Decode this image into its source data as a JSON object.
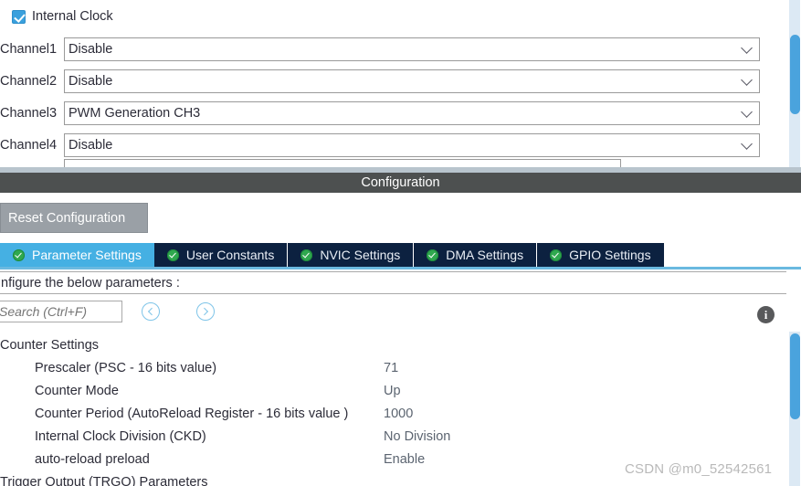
{
  "mode_panel": {
    "internal_clock": {
      "label": "Internal Clock",
      "checked": true
    },
    "channels": [
      {
        "label": "Channel1",
        "value": "Disable"
      },
      {
        "label": "Channel2",
        "value": "Disable"
      },
      {
        "label": "Channel3",
        "value": "PWM Generation CH3"
      },
      {
        "label": "Channel4",
        "value": "Disable"
      }
    ]
  },
  "configuration": {
    "title": "Configuration",
    "reset_button": "Reset Configuration"
  },
  "tabs": [
    {
      "label": "Parameter Settings",
      "active": true,
      "has_check": true
    },
    {
      "label": "User Constants",
      "active": false,
      "has_check": true
    },
    {
      "label": "NVIC Settings",
      "active": false,
      "has_check": true
    },
    {
      "label": "DMA Settings",
      "active": false,
      "has_check": true
    },
    {
      "label": "GPIO Settings",
      "active": false,
      "has_check": true
    }
  ],
  "parameter_panel": {
    "configure_label": "nfigure the below parameters :",
    "search_placeholder": "Search (Ctrl+F)",
    "search_value": "",
    "prev_icon": "chevron-left-circle-icon",
    "next_icon": "chevron-right-circle-icon",
    "info_icon": "info-icon",
    "info_glyph": "i",
    "groups": [
      {
        "name": "Counter Settings",
        "params": [
          {
            "name": "Prescaler (PSC - 16 bits value)",
            "value": "71"
          },
          {
            "name": "Counter Mode",
            "value": "Up"
          },
          {
            "name": "Counter Period (AutoReload Register - 16 bits value )",
            "value": "1000"
          },
          {
            "name": "Internal Clock Division (CKD)",
            "value": "No Division"
          },
          {
            "name": "auto-reload preload",
            "value": "Enable"
          }
        ]
      },
      {
        "name": "Trigger Output (TRGO) Parameters",
        "params": []
      }
    ]
  },
  "watermark": "CSDN @m0_52542561",
  "colors": {
    "accent_blue": "#45b0e3",
    "tab_navy": "#0c2140",
    "config_bar": "#4d5050",
    "reset_button": "#9aa0a6",
    "check_green": "#2fa84f",
    "scrollbar_thumb": "#4aa3dd",
    "scrollbar_track": "#dce9f4",
    "separator": "#b8c4cd"
  }
}
